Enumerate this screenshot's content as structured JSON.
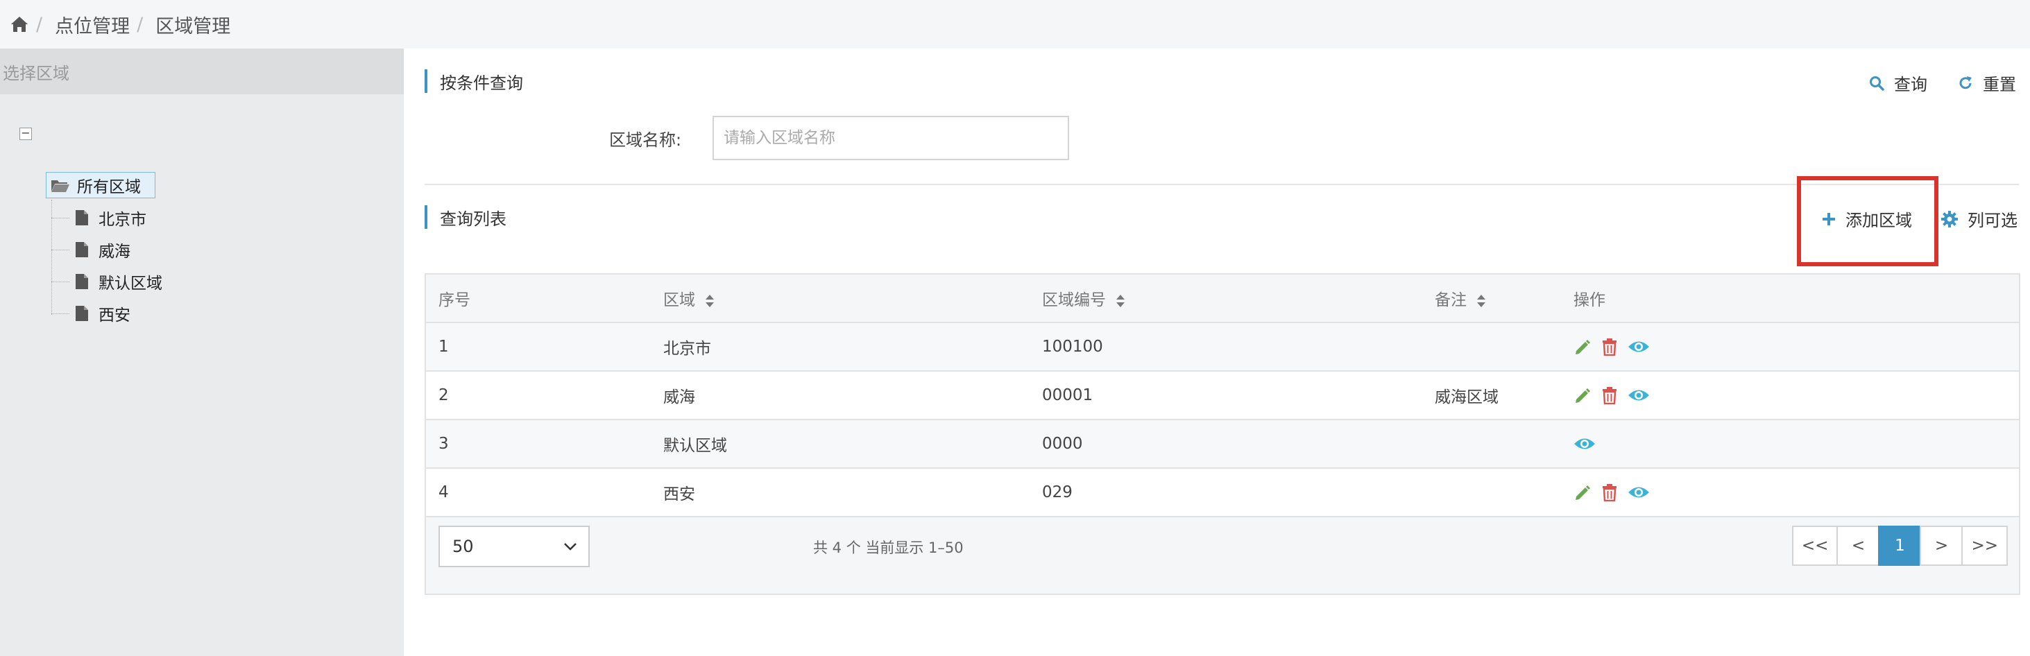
{
  "breadcrumb": {
    "home_icon": "home-icon",
    "separator": "/",
    "items": [
      "点位管理",
      "区域管理"
    ]
  },
  "sidebar": {
    "header": "选择区域",
    "tree": {
      "root": "所有区域",
      "children": [
        "北京市",
        "威海",
        "默认区域",
        "西安"
      ]
    }
  },
  "query": {
    "section_title": "按条件查询",
    "search_label": "查询",
    "reset_label": "重置",
    "field_label": "区域名称:",
    "field_placeholder": "请输入区域名称",
    "field_value": ""
  },
  "list": {
    "section_title": "查询列表",
    "add_label": "添加区域",
    "columns_label": "列可选",
    "columns": [
      "序号",
      "区域",
      "区域编号",
      "备注",
      "操作"
    ],
    "rows": [
      {
        "index": "1",
        "region": "北京市",
        "code": "100100",
        "note": "",
        "actions": [
          "edit-icon",
          "delete-icon",
          "view-icon"
        ]
      },
      {
        "index": "2",
        "region": "威海",
        "code": "00001",
        "note": "威海区域",
        "actions": [
          "edit-icon",
          "delete-icon",
          "view-icon"
        ]
      },
      {
        "index": "3",
        "region": "默认区域",
        "code": "0000",
        "note": "",
        "actions": [
          "view-icon"
        ]
      },
      {
        "index": "4",
        "region": "西安",
        "code": "029",
        "note": "",
        "actions": [
          "edit-icon",
          "delete-icon",
          "view-icon"
        ]
      }
    ]
  },
  "pagination": {
    "page_size": "50",
    "summary": "共 4 个 当前显示 1–50",
    "buttons": [
      "<<",
      "<",
      "1",
      ">",
      ">>"
    ],
    "current_page": "1"
  },
  "colors": {
    "accent": "#3b93c6",
    "highlight": "#d9332b",
    "edit": "#6aa84f",
    "delete": "#d9534f",
    "view": "#3bb3d6"
  }
}
